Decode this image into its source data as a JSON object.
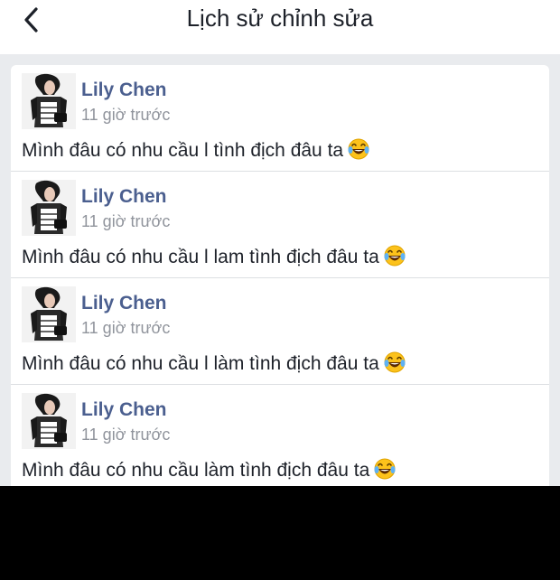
{
  "header": {
    "title": "Lịch sử chỉnh sửa",
    "back_icon": "chevron-left-icon"
  },
  "entries": [
    {
      "author": "Lily Chen",
      "time": "11 giờ trước",
      "text": "Mình đâu có nhu cầu l tình địch đâu ta",
      "emoji": "laughing-tears-emoji"
    },
    {
      "author": "Lily Chen",
      "time": "11 giờ trước",
      "text": "Mình đâu có nhu cầu l lam tình địch đâu ta",
      "emoji": "laughing-tears-emoji"
    },
    {
      "author": "Lily Chen",
      "time": "11 giờ trước",
      "text": "Mình đâu có nhu cầu l làm tình địch đâu ta",
      "emoji": "laughing-tears-emoji"
    },
    {
      "author": "Lily Chen",
      "time": "11 giờ trước",
      "text": "Mình đâu có nhu cầu làm tình địch đâu ta",
      "emoji": "laughing-tears-emoji"
    }
  ],
  "colors": {
    "name": "#4b5f8f",
    "time": "#90949c",
    "background": "#e9ebee"
  }
}
